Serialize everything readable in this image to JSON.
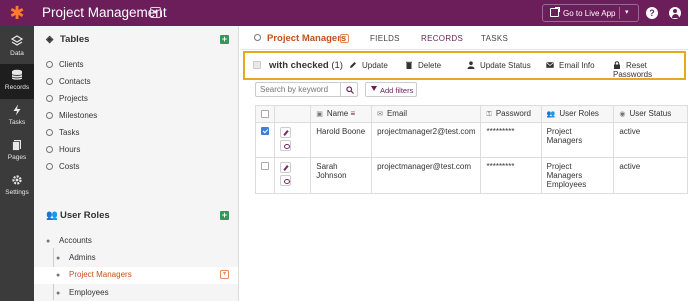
{
  "app": {
    "title": "Project Management",
    "go_live_label": "Go to Live App"
  },
  "rail": [
    {
      "label": "Data",
      "icon": "data-icon"
    },
    {
      "label": "Records",
      "icon": "records-icon"
    },
    {
      "label": "Tasks",
      "icon": "tasks-icon"
    },
    {
      "label": "Pages",
      "icon": "pages-icon"
    },
    {
      "label": "Settings",
      "icon": "settings-icon"
    }
  ],
  "sidebar": {
    "tables_title": "Tables",
    "tables": [
      "Clients",
      "Contacts",
      "Projects",
      "Milestones",
      "Tasks",
      "Hours",
      "Costs"
    ],
    "roles_title": "User Roles",
    "roles": [
      {
        "label": "Accounts"
      },
      {
        "label": "Admins"
      },
      {
        "label": "Project Managers"
      },
      {
        "label": "Employees"
      }
    ]
  },
  "main": {
    "object_title": "Project Managers",
    "tabs": [
      "FIELDS",
      "RECORDS",
      "TASKS"
    ],
    "active_tab": "RECORDS",
    "actions": {
      "with_checked": "with checked",
      "checked_count": "(1)",
      "update": "Update",
      "delete": "Delete",
      "update_status": "Update Status",
      "email_info": "Email Info",
      "reset_passwords": "Reset Passwords"
    },
    "search_placeholder": "Search by keyword",
    "add_filters": "Add filters",
    "columns": [
      "Name",
      "Email",
      "Password",
      "User Roles",
      "User Status"
    ],
    "rows": [
      {
        "checked": true,
        "name": "Harold Boone",
        "email": "projectmanager2@test.com",
        "password": "*********",
        "roles": "Project Managers",
        "roles2": "",
        "status": "active"
      },
      {
        "checked": false,
        "name": "Sarah Johnson",
        "email": "projectmanager@test.com",
        "password": "*********",
        "roles": "Project Managers",
        "roles2": "Employees",
        "status": "active"
      }
    ]
  },
  "colors": {
    "brand": "#6b1e5a",
    "accent": "#c0521f",
    "highlight": "#e5a823",
    "add": "#2d9c5a"
  }
}
